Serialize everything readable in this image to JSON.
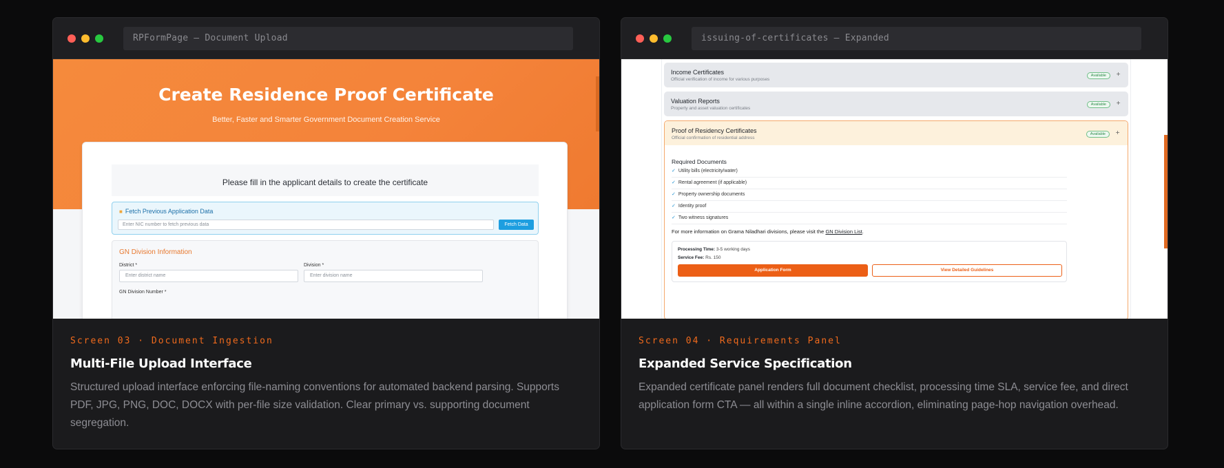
{
  "cards": [
    {
      "url_bar": "RPFormPage — Document Upload",
      "kicker": "Screen 03 · Document Ingestion",
      "title": "Multi-File Upload Interface",
      "description": "Structured upload interface enforcing file-naming conventions for automated backend parsing. Supports PDF, JPG, PNG, DOC, DOCX with per-file size validation. Clear primary vs. supporting document segregation.",
      "screen": {
        "hero_title": "Create Residence Proof Certificate",
        "hero_subtitle": "Better, Faster and Smarter Government Document Creation Service",
        "intro": "Please fill in the applicant details to create the certificate",
        "fetch": {
          "title": "Fetch Previous Application Data",
          "placeholder": "Enter NIC number to fetch previous data",
          "button": "Fetch Data"
        },
        "gn_section": {
          "title": "GN Division Information",
          "district_label": "District *",
          "district_placeholder": "Enter district name",
          "division_label": "Division *",
          "division_placeholder": "Enter division name",
          "gn_number_label": "GN Division Number *"
        }
      }
    },
    {
      "url_bar": "issuing-of-certificates — Expanded",
      "kicker": "Screen 04 · Requirements Panel",
      "title": "Expanded Service Specification",
      "description": "Expanded certificate panel renders full document checklist, processing time SLA, service fee, and direct application form CTA — all within a single inline accordion, eliminating page-hop navigation overhead.",
      "screen": {
        "rows": [
          {
            "title": "Income Certificates",
            "subtitle": "Official verification of income for various purposes",
            "badge": "Available",
            "toggle": "+"
          },
          {
            "title": "Valuation Reports",
            "subtitle": "Property and asset valuation certificates",
            "badge": "Available",
            "toggle": "+"
          }
        ],
        "expanded": {
          "title": "Proof of Residency Certificates",
          "subtitle": "Official confirmation of residential address",
          "badge": "Available",
          "toggle": "+",
          "required_title": "Required Documents",
          "check": "✓",
          "required_items": [
            "Utility bills (electricity/water)",
            "Rental agreement (if applicable)",
            "Property ownership documents",
            "Identity proof",
            "Two witness signatures"
          ],
          "info_prefix": "For more information on Grama Niladhari divisions, please visit the",
          "info_link": "GN Division List",
          "info_suffix": ".",
          "processing_label": "Processing Time:",
          "processing_value": "3-5 working days",
          "fee_label": "Service Fee:",
          "fee_value": "Rs. 150",
          "primary_button": "Application Form",
          "secondary_button": "View Detailed Guidelines"
        }
      }
    }
  ],
  "colors": {
    "page_bg": "#0b0b0c",
    "card_bg": "#1b1b1d",
    "accent": "#f06a1c",
    "hero_orange": "#f58a3c",
    "fetch_blue": "#1d9ee0",
    "badge_green": "#2e8b4a"
  }
}
